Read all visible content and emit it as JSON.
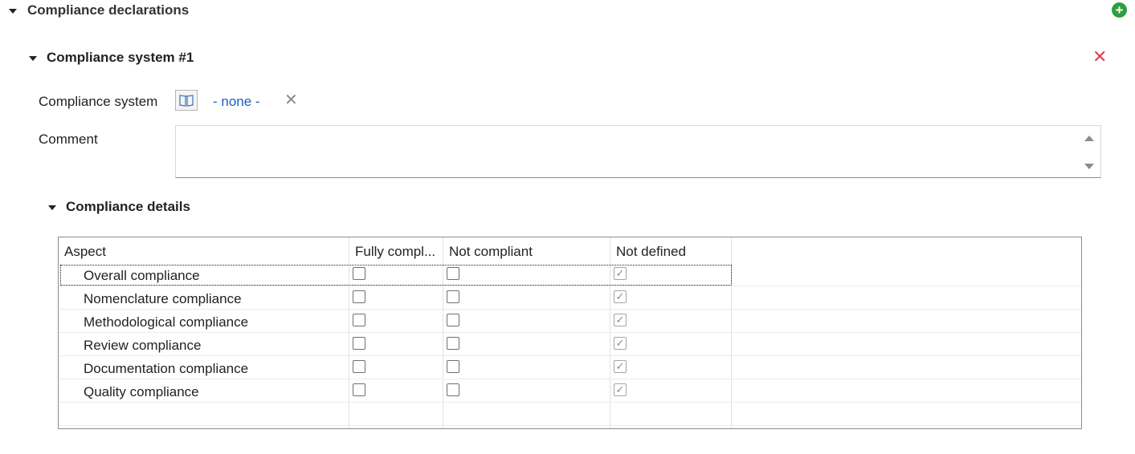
{
  "section": {
    "title": "Compliance declarations",
    "add_icon": "plus-circle-icon"
  },
  "system": {
    "title": "Compliance system #1",
    "delete_icon": "close-icon",
    "field_label": "Compliance system",
    "field_value": "- none -",
    "browse_icon": "book-icon",
    "clear_icon": "clear-icon",
    "comment_label": "Comment",
    "comment_value": ""
  },
  "details": {
    "title": "Compliance details",
    "columns": [
      "Aspect",
      "Fully compl...",
      "Not compliant",
      "Not defined"
    ],
    "rows": [
      {
        "aspect": "Overall compliance",
        "fully": false,
        "not": false,
        "undefined": true
      },
      {
        "aspect": "Nomenclature compliance",
        "fully": false,
        "not": false,
        "undefined": true
      },
      {
        "aspect": "Methodological compliance",
        "fully": false,
        "not": false,
        "undefined": true
      },
      {
        "aspect": "Review compliance",
        "fully": false,
        "not": false,
        "undefined": true
      },
      {
        "aspect": "Documentation compliance",
        "fully": false,
        "not": false,
        "undefined": true
      },
      {
        "aspect": "Quality compliance",
        "fully": false,
        "not": false,
        "undefined": true
      }
    ]
  },
  "colors": {
    "add": "#2e9e3e",
    "delete": "#e0404f",
    "link": "#1f5fbf"
  }
}
